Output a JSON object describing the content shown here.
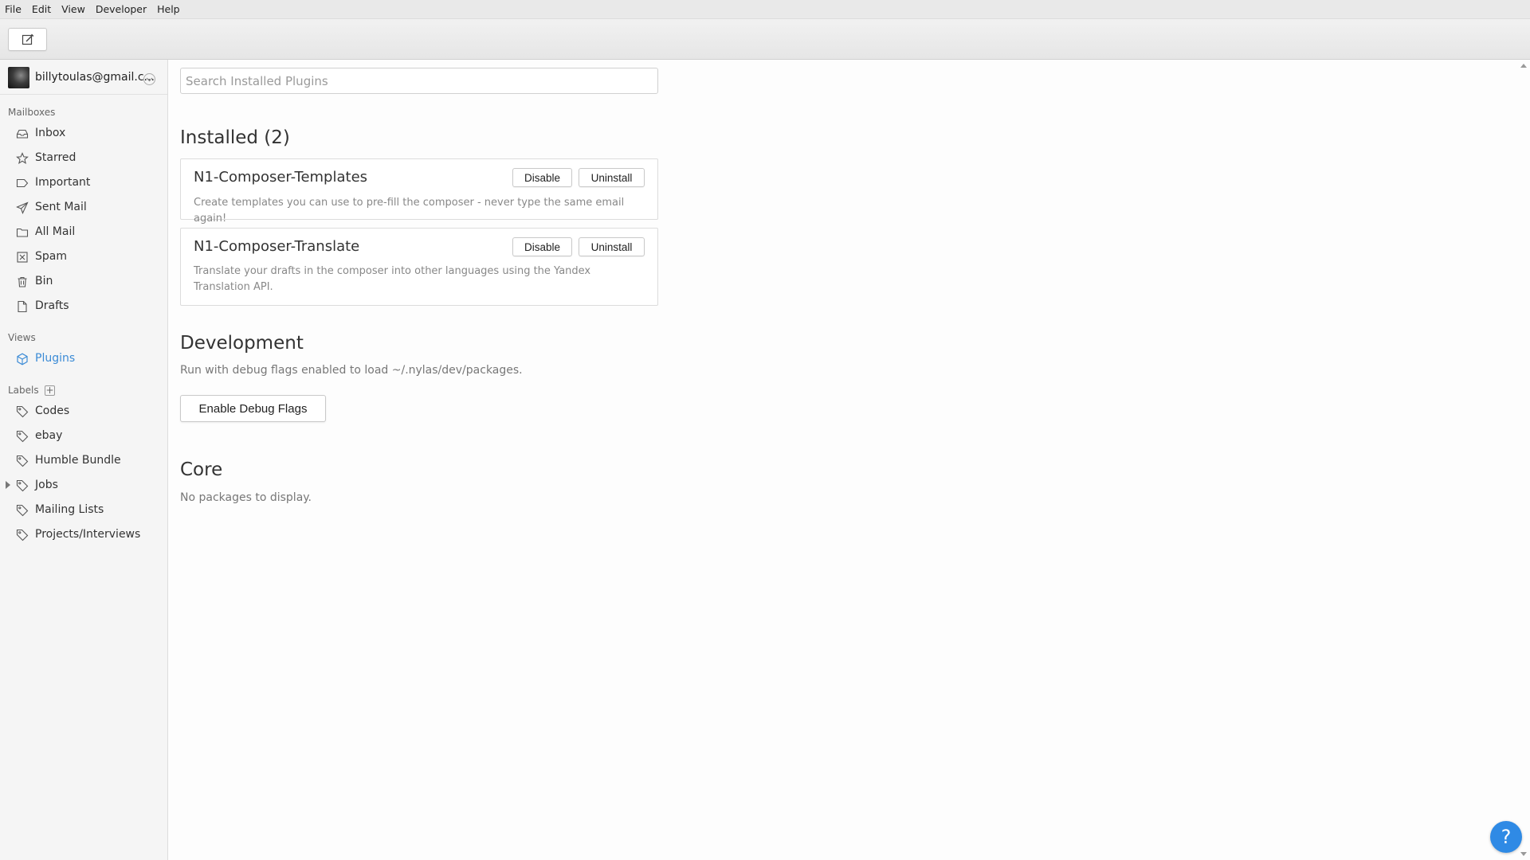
{
  "menubar": {
    "items": [
      "File",
      "Edit",
      "View",
      "Developer",
      "Help"
    ]
  },
  "toolbar": {
    "compose_icon": "compose-icon"
  },
  "account": {
    "email": "billytoulas@gmail.c..."
  },
  "sidebar": {
    "mailboxes_heading": "Mailboxes",
    "mailboxes": [
      {
        "label": "Inbox",
        "icon": "inbox-icon"
      },
      {
        "label": "Starred",
        "icon": "star-icon"
      },
      {
        "label": "Important",
        "icon": "important-icon"
      },
      {
        "label": "Sent Mail",
        "icon": "send-icon"
      },
      {
        "label": "All Mail",
        "icon": "folder-icon"
      },
      {
        "label": "Spam",
        "icon": "spam-icon"
      },
      {
        "label": "Bin",
        "icon": "trash-icon"
      },
      {
        "label": "Drafts",
        "icon": "draft-icon"
      }
    ],
    "views_heading": "Views",
    "views": [
      {
        "label": "Plugins",
        "icon": "plugins-icon",
        "selected": true
      }
    ],
    "labels_heading": "Labels",
    "labels": [
      {
        "label": "Codes",
        "icon": "tag-icon"
      },
      {
        "label": "ebay",
        "icon": "tag-icon"
      },
      {
        "label": "Humble Bundle",
        "icon": "tag-icon"
      },
      {
        "label": "Jobs",
        "icon": "tag-icon",
        "expandable": true
      },
      {
        "label": "Mailing Lists",
        "icon": "tag-icon"
      },
      {
        "label": "Projects/Interviews",
        "icon": "tag-icon"
      }
    ]
  },
  "main": {
    "search_placeholder": "Search Installed Plugins",
    "installed_heading": "Installed (2)",
    "plugins": [
      {
        "name": "N1-Composer-Templates",
        "description": "Create templates you can use to pre-fill the composer - never type the same email again!",
        "disable_label": "Disable",
        "uninstall_label": "Uninstall"
      },
      {
        "name": "N1-Composer-Translate",
        "description": "Translate your drafts in the composer into other languages using the Yandex Translation API.",
        "disable_label": "Disable",
        "uninstall_label": "Uninstall"
      }
    ],
    "development_heading": "Development",
    "development_text": "Run with debug flags enabled to load ~/.nylas/dev/packages.",
    "debug_button_label": "Enable Debug Flags",
    "core_heading": "Core",
    "core_text": "No packages to display."
  },
  "help": {
    "label": "?"
  },
  "colors": {
    "accent": "#3b8bd6",
    "help_button": "#2f8ae5"
  }
}
